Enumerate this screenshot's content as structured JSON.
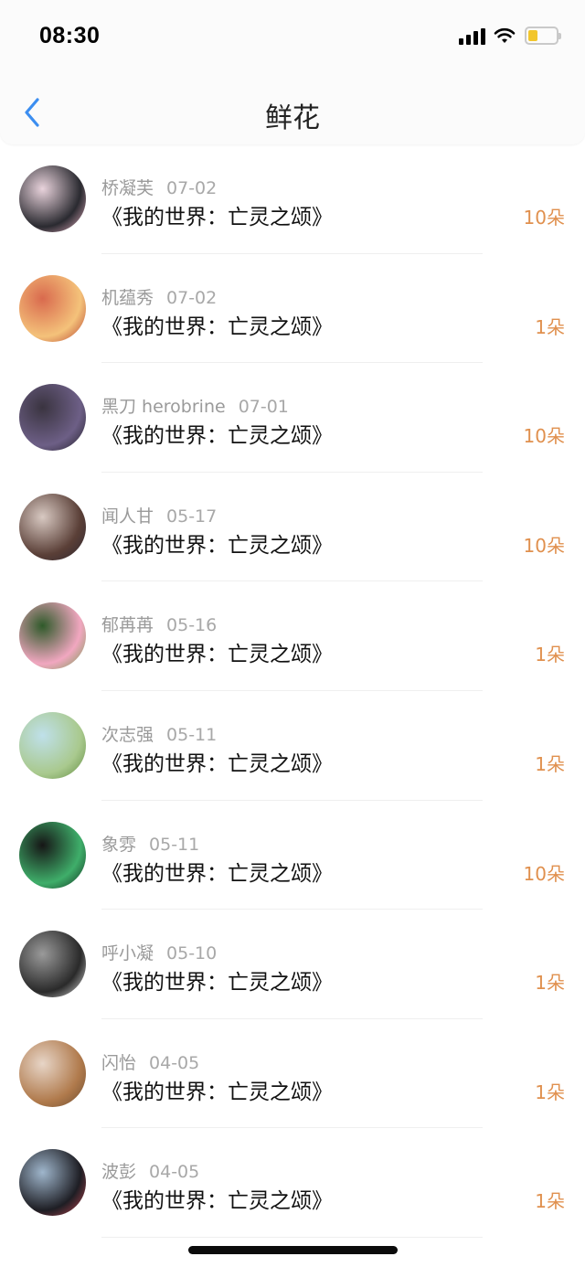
{
  "status_bar": {
    "time": "08:30",
    "battery_color": "#f2c62c"
  },
  "header": {
    "title": "鲜花",
    "back_icon": "chevron-left-icon"
  },
  "list": [
    {
      "name": "桥凝芙",
      "date": "07-02",
      "title": "《我的世界：亡灵之颂》",
      "count": "10朵",
      "avatar_colors": [
        "#e9d3dc",
        "#2a2a30",
        "#f0b7c8"
      ]
    },
    {
      "name": "机蕴秀",
      "date": "07-02",
      "title": "《我的世界：亡灵之颂》",
      "count": "1朵",
      "avatar_colors": [
        "#d96a4e",
        "#f4c27a",
        "#b23a2c"
      ]
    },
    {
      "name": "黑刀 herobrine",
      "date": "07-01",
      "title": "《我的世界：亡灵之颂》",
      "count": "10朵",
      "avatar_colors": [
        "#3a3440",
        "#6d5f86",
        "#1f1c25"
      ]
    },
    {
      "name": "闻人甘",
      "date": "05-17",
      "title": "《我的世界：亡灵之颂》",
      "count": "10朵",
      "avatar_colors": [
        "#d8c9c2",
        "#5a3f37",
        "#2b2530"
      ]
    },
    {
      "name": "郁苒苒",
      "date": "05-16",
      "title": "《我的世界：亡灵之颂》",
      "count": "1朵",
      "avatar_colors": [
        "#2f5a2a",
        "#f1a7c0",
        "#6e9b4a"
      ]
    },
    {
      "name": "次志强",
      "date": "05-11",
      "title": "《我的世界：亡灵之颂》",
      "count": "1朵",
      "avatar_colors": [
        "#bfe0ea",
        "#a9c98e",
        "#5f8a3e"
      ]
    },
    {
      "name": "象雰",
      "date": "05-11",
      "title": "《我的世界：亡灵之颂》",
      "count": "10朵",
      "avatar_colors": [
        "#161616",
        "#3fae6a",
        "#0d2a19"
      ]
    },
    {
      "name": "呼小凝",
      "date": "05-10",
      "title": "《我的世界：亡灵之颂》",
      "count": "1朵",
      "avatar_colors": [
        "#9a9a9a",
        "#2a2a2a",
        "#e5e5e5"
      ]
    },
    {
      "name": "闪怡",
      "date": "04-05",
      "title": "《我的世界：亡灵之颂》",
      "count": "1朵",
      "avatar_colors": [
        "#e7d5c7",
        "#b07a4c",
        "#6a4a2e"
      ]
    },
    {
      "name": "波彭",
      "date": "04-05",
      "title": "《我的世界：亡灵之颂》",
      "count": "1朵",
      "avatar_colors": [
        "#9fb6cc",
        "#1e1e24",
        "#c84a54"
      ]
    }
  ],
  "colors": {
    "accent": "#e0904e",
    "back_icon": "#3c8ef0"
  }
}
